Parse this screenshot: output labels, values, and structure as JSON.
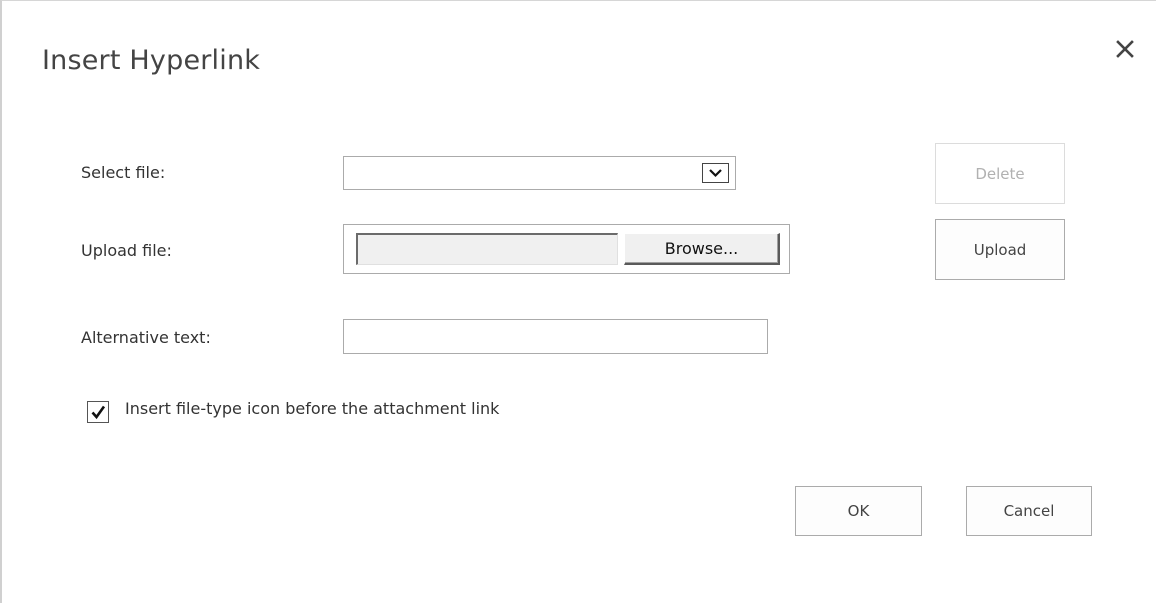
{
  "dialog": {
    "title": "Insert Hyperlink",
    "close_icon": "close-icon"
  },
  "select_file": {
    "label": "Select file:",
    "value": "",
    "arrow_icon": "chevron-down-icon"
  },
  "delete_button": {
    "label": "Delete",
    "enabled": false
  },
  "upload_file": {
    "label": "Upload file:",
    "path_value": "",
    "browse_label": "Browse..."
  },
  "upload_button": {
    "label": "Upload"
  },
  "alternative_text": {
    "label": "Alternative text:",
    "value": ""
  },
  "insert_icon_option": {
    "label": "Insert file-type icon before the attachment link",
    "checked": true,
    "check_icon": "checkmark-icon"
  },
  "ok_button": {
    "label": "OK"
  },
  "cancel_button": {
    "label": "Cancel"
  },
  "colors": {
    "border": "#ababab",
    "disabled_text": "#b1b1b1",
    "text": "#333333"
  }
}
